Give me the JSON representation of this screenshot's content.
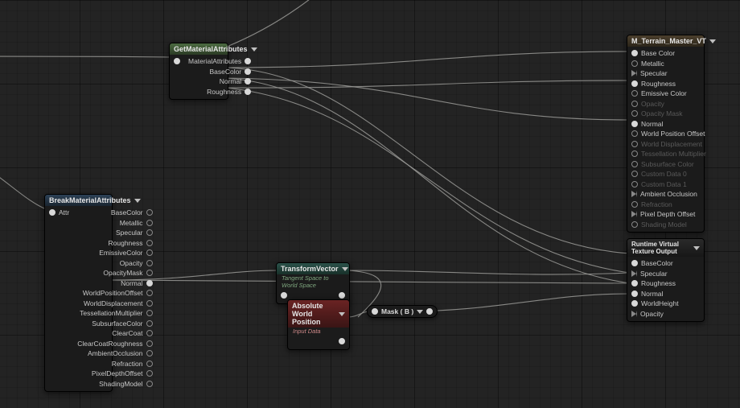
{
  "nodes": {
    "getMat": {
      "title": "GetMaterialAttributes",
      "outputs": [
        "MaterialAttributes",
        "BaseColor",
        "Normal",
        "Roughness"
      ]
    },
    "breakMat": {
      "title": "BreakMaterialAttributes",
      "input": "Attr",
      "outputs": [
        {
          "label": "BaseColor",
          "connected": false
        },
        {
          "label": "Metallic",
          "connected": false
        },
        {
          "label": "Specular",
          "connected": false
        },
        {
          "label": "Roughness",
          "connected": false
        },
        {
          "label": "EmissiveColor",
          "connected": false
        },
        {
          "label": "Opacity",
          "connected": false
        },
        {
          "label": "OpacityMask",
          "connected": false
        },
        {
          "label": "Normal",
          "connected": true
        },
        {
          "label": "WorldPositionOffset",
          "connected": false
        },
        {
          "label": "WorldDisplacement",
          "connected": false
        },
        {
          "label": "TessellationMultiplier",
          "connected": false
        },
        {
          "label": "SubsurfaceColor",
          "connected": false
        },
        {
          "label": "ClearCoat",
          "connected": false
        },
        {
          "label": "ClearCoatRoughness",
          "connected": false
        },
        {
          "label": "AmbientOcclusion",
          "connected": false
        },
        {
          "label": "Refraction",
          "connected": false
        },
        {
          "label": "PixelDepthOffset",
          "connected": false
        },
        {
          "label": "ShadingModel",
          "connected": false
        }
      ]
    },
    "transform": {
      "title": "TransformVector",
      "sub": "Tangent Space to World Space"
    },
    "absWorld": {
      "title": "Absolute World Position",
      "sub": "Input Data"
    },
    "mask": {
      "title": "Mask ( B )"
    },
    "terrain": {
      "title": "M_Terrain_Master_VT",
      "inputs": [
        {
          "label": "Base Color",
          "connected": true,
          "dim": false
        },
        {
          "label": "Metallic",
          "connected": false,
          "dim": false
        },
        {
          "label": "Specular",
          "connected": false,
          "dim": false,
          "tri": true
        },
        {
          "label": "Roughness",
          "connected": true,
          "dim": false
        },
        {
          "label": "Emissive Color",
          "connected": false,
          "dim": false
        },
        {
          "label": "Opacity",
          "connected": false,
          "dim": true
        },
        {
          "label": "Opacity Mask",
          "connected": false,
          "dim": true
        },
        {
          "label": "Normal",
          "connected": true,
          "dim": false
        },
        {
          "label": "World Position Offset",
          "connected": false,
          "dim": false
        },
        {
          "label": "World Displacement",
          "connected": false,
          "dim": true
        },
        {
          "label": "Tessellation Multiplier",
          "connected": false,
          "dim": true
        },
        {
          "label": "Subsurface Color",
          "connected": false,
          "dim": true
        },
        {
          "label": "Custom Data 0",
          "connected": false,
          "dim": true
        },
        {
          "label": "Custom Data 1",
          "connected": false,
          "dim": true
        },
        {
          "label": "Ambient Occlusion",
          "connected": false,
          "dim": false,
          "tri": true
        },
        {
          "label": "Refraction",
          "connected": false,
          "dim": true
        },
        {
          "label": "Pixel Depth Offset",
          "connected": false,
          "dim": false,
          "tri": true
        },
        {
          "label": "Shading Model",
          "connected": false,
          "dim": true
        }
      ]
    },
    "rvt": {
      "title": "Runtime Virtual Texture Output",
      "inputs": [
        {
          "label": "BaseColor",
          "connected": true
        },
        {
          "label": "Specular",
          "connected": false,
          "tri": true
        },
        {
          "label": "Roughness",
          "connected": true
        },
        {
          "label": "Normal",
          "connected": true
        },
        {
          "label": "WorldHeight",
          "connected": true
        },
        {
          "label": "Opacity",
          "connected": false,
          "tri": true
        }
      ]
    }
  }
}
